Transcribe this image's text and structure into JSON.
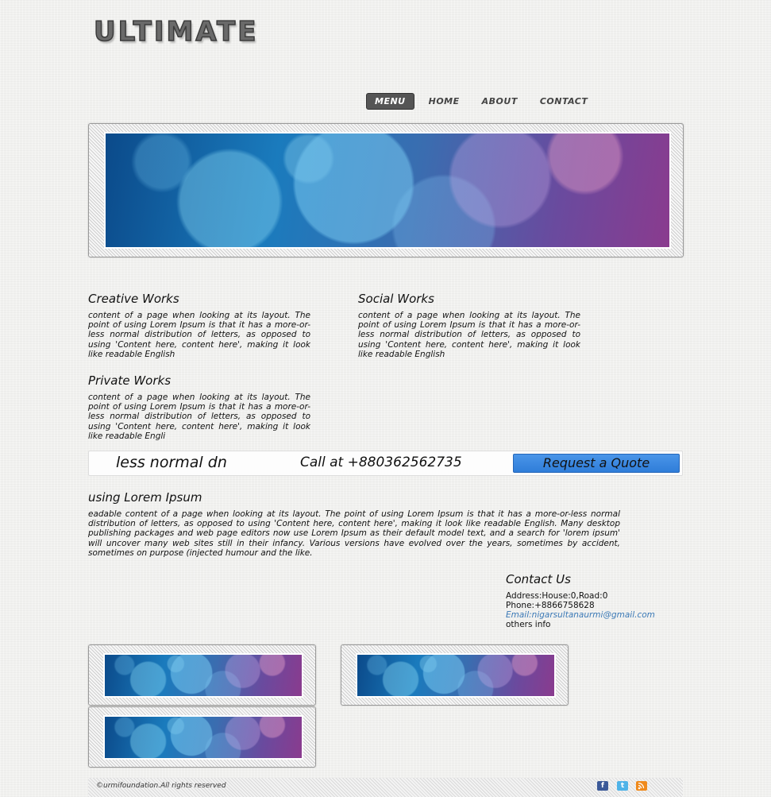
{
  "logo": {
    "text": "ULTIMATE"
  },
  "nav": {
    "items": [
      {
        "label": "MENU"
      },
      {
        "label": "HOME"
      },
      {
        "label": "ABOUT"
      },
      {
        "label": "CONTACT"
      }
    ]
  },
  "sections": {
    "creative": {
      "title": "Creative Works",
      "text": "content of a page when looking at its layout. The point of using Lorem Ipsum is that it has a more-or-less normal distribution of letters, as opposed to using 'Content here, content here', making it look like readable English"
    },
    "social": {
      "title": "Social Works",
      "text": "content of a page when looking at its layout. The point of using Lorem Ipsum is that it has a more-or-less normal distribution of letters, as opposed to using 'Content here, content here', making it look like readable English"
    },
    "private": {
      "title": "Private Works",
      "text": "content of a page when looking at its layout. The point of using Lorem Ipsum is that it has a more-or-less normal distribution of letters, as opposed to using 'Content here, content here', making it look like readable Engli"
    }
  },
  "quote_bar": {
    "marquee_text": "less normal dn",
    "call_text": "Call at +880362562735",
    "button_label": "Request a Quote"
  },
  "lorem": {
    "title": "using Lorem Ipsum",
    "text": "eadable content of a page when looking at its layout. The point of using Lorem Ipsum is that it has a more-or-less normal distribution of letters, as opposed to using 'Content here, content here', making it look like readable English. Many desktop publishing packages and web page editors now use Lorem Ipsum as their default model text, and a search for 'lorem ipsum' will uncover many web sites still in their infancy. Various versions have evolved over the years, sometimes by accident, sometimes on purpose (injected humour and the like."
  },
  "contact": {
    "title": "Contact Us",
    "address": "Address:House:0,Road:0",
    "phone": "Phone:+8866758628",
    "email": "Email:nigarsultanaurmi@gmail.com",
    "other": "others info"
  },
  "footer": {
    "copyright": "©urmifoundation.All rights reserved",
    "icons": [
      "facebook-icon",
      "twitter-icon",
      "rss-icon"
    ]
  },
  "colors": {
    "nav_active_bg": "#555555",
    "button_blue": "#3a88e0",
    "link_blue": "#3b79b6"
  }
}
